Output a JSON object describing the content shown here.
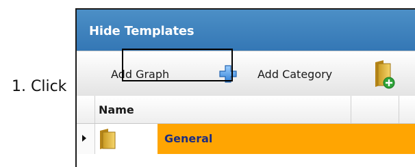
{
  "annotation": {
    "step_text": "1. Click"
  },
  "window": {
    "title": "Hide Templates"
  },
  "toolbar": {
    "add_graph_label": "Add Graph",
    "add_category_label": "Add Category",
    "icons": [
      "plus-icon",
      "folder-add-icon"
    ]
  },
  "grid": {
    "columns": [
      "Name"
    ],
    "rows": [
      {
        "name": "General",
        "icon": "folder-icon",
        "selected": true
      }
    ]
  },
  "colors": {
    "titlebar": "#3a7fbc",
    "selected_row": "#ffa502",
    "row_text": "#1c2c80"
  }
}
